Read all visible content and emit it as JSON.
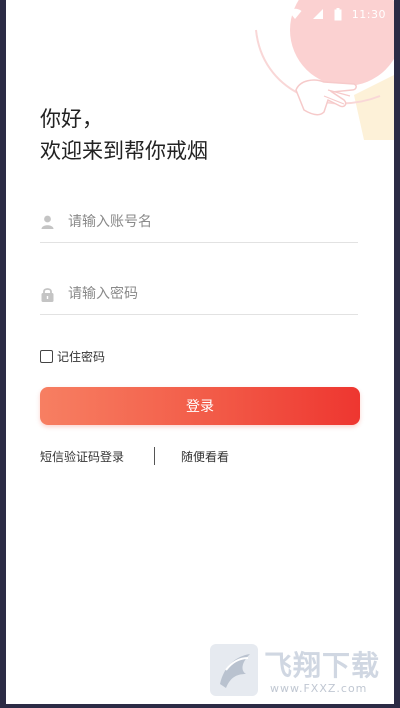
{
  "status_bar": {
    "time": "11:30",
    "icons": [
      "wifi-icon",
      "signal-icon",
      "battery-icon"
    ]
  },
  "greeting": {
    "line1": "你好，",
    "line2": "欢迎来到帮你戒烟"
  },
  "username": {
    "placeholder": "请输入账号名",
    "value": "",
    "icon": "user-icon"
  },
  "password": {
    "placeholder": "请输入密码",
    "value": "",
    "icon": "lock-icon"
  },
  "remember": {
    "label": "记住密码",
    "checked": false
  },
  "login_button": {
    "label": "登录"
  },
  "links": {
    "sms_login": "短信验证码登录",
    "browse": "随便看看"
  },
  "watermark": {
    "text": "飞翔下载",
    "url": "www.FXXZ.com"
  },
  "colors": {
    "accent_start": "#f77f62",
    "accent_end": "#ee3630",
    "background": "#ffffff",
    "text": "#222222"
  }
}
